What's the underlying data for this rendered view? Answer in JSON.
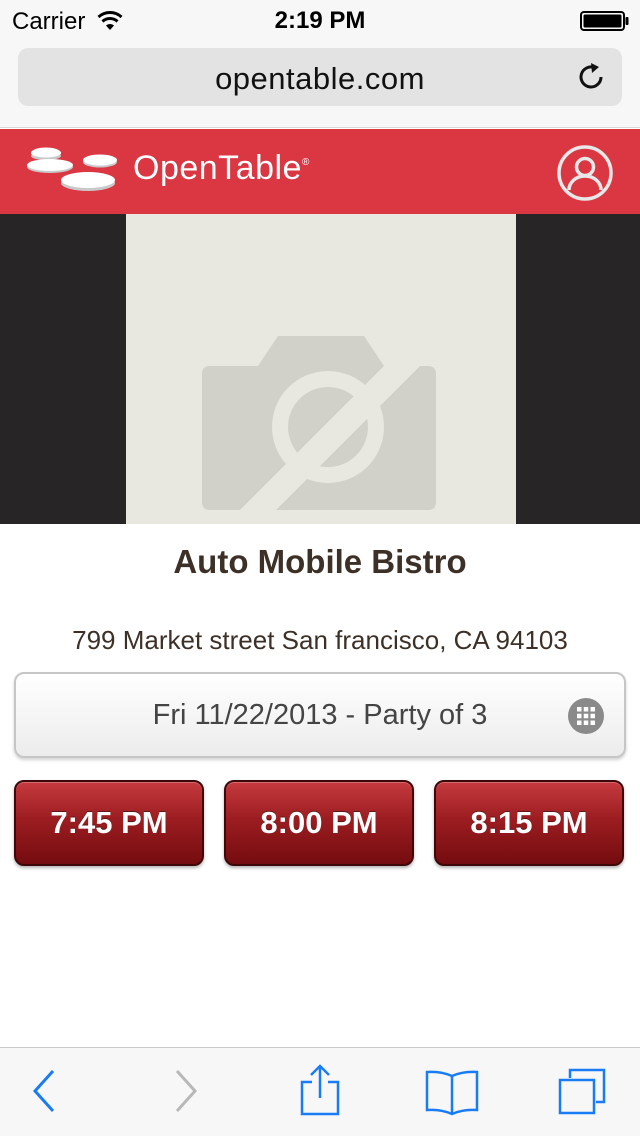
{
  "status_bar": {
    "carrier": "Carrier",
    "time": "2:19 PM"
  },
  "browser": {
    "url": "opentable.com"
  },
  "header": {
    "brand": "OpenTable",
    "registered": "®"
  },
  "restaurant": {
    "name": "Auto Mobile Bistro",
    "address": "799 Market street San francisco, CA 94103"
  },
  "reservation": {
    "selector_label": "Fri 11/22/2013 - Party of 3",
    "times": [
      "7:45 PM",
      "8:00 PM",
      "8:15 PM"
    ]
  },
  "colors": {
    "brand_red": "#da3743",
    "time_button": "#9c1d21",
    "ios_blue": "#1a7cf5"
  },
  "icons": [
    "wifi-icon",
    "battery-icon",
    "reload-icon",
    "profile-icon",
    "no-photo-icon",
    "grid-icon",
    "back-icon",
    "forward-icon",
    "share-icon",
    "bookmarks-icon",
    "tabs-icon"
  ]
}
